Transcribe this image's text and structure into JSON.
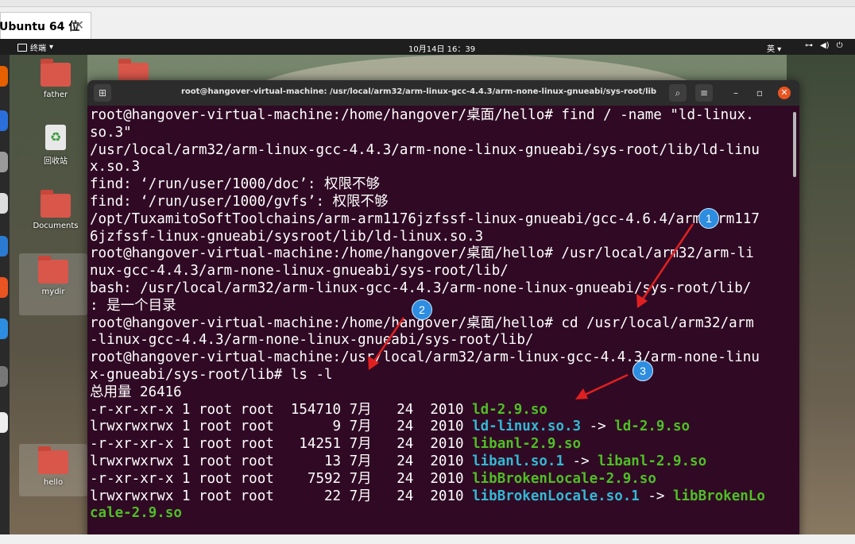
{
  "vm_window": {
    "tab_label": "Ubuntu 64 位",
    "tab_close": "✕"
  },
  "gnome_topbar": {
    "activities_label": "终端",
    "clock": "10月14日  16：39",
    "input_method": "英"
  },
  "desktop_icons": [
    {
      "label": "father"
    },
    {
      "label": "回收站"
    },
    {
      "label": "Documents"
    },
    {
      "label": "mydir"
    },
    {
      "label": "hello"
    }
  ],
  "terminal": {
    "title": "root@hangover-virtual-machine: /usr/local/arm32/arm-linux-gcc-4.4.3/arm-none-linux-gnueabi/sys-root/lib",
    "lines": [
      "root@hangover-virtual-machine:/home/hangover/桌面/hello# find / -name \"ld-linux.",
      "so.3\"",
      "/usr/local/arm32/arm-linux-gcc-4.4.3/arm-none-linux-gnueabi/sys-root/lib/ld-linu",
      "x.so.3",
      "find: ‘/run/user/1000/doc’: 权限不够",
      "find: ‘/run/user/1000/gvfs’: 权限不够",
      "/opt/TuxamitoSoftToolchains/arm-arm1176jzfssf-linux-gnueabi/gcc-4.6.4/arm-arm117",
      "6jzfssf-linux-gnueabi/sysroot/lib/ld-linux.so.3",
      "root@hangover-virtual-machine:/home/hangover/桌面/hello# /usr/local/arm32/arm-li",
      "nux-gcc-4.4.3/arm-none-linux-gnueabi/sys-root/lib/",
      "bash: /usr/local/arm32/arm-linux-gcc-4.4.3/arm-none-linux-gnueabi/sys-root/lib/",
      ": 是一个目录",
      "root@hangover-virtual-machine:/home/hangover/桌面/hello# cd /usr/local/arm32/arm",
      "-linux-gcc-4.4.3/arm-none-linux-gnueabi/sys-root/lib/",
      "root@hangover-virtual-machine:/usr/local/arm32/arm-linux-gcc-4.4.3/arm-none-linu",
      "x-gnueabi/sys-root/lib# ls -l",
      "总用量 26416"
    ],
    "listing": [
      {
        "perms": "-r-xr-xr-x 1 root root  154710 7月   24  2010 ",
        "name": "ld-2.9.so",
        "kind": "exec",
        "arrow": "",
        "target": ""
      },
      {
        "perms": "lrwxrwxrwx 1 root root       9 7月   24  2010 ",
        "name": "ld-linux.so.3",
        "kind": "link",
        "arrow": " -> ",
        "target": "ld-2.9.so"
      },
      {
        "perms": "-r-xr-xr-x 1 root root   14251 7月   24  2010 ",
        "name": "libanl-2.9.so",
        "kind": "exec",
        "arrow": "",
        "target": ""
      },
      {
        "perms": "lrwxrwxrwx 1 root root      13 7月   24  2010 ",
        "name": "libanl.so.1",
        "kind": "link",
        "arrow": " -> ",
        "target": "libanl-2.9.so"
      },
      {
        "perms": "-r-xr-xr-x 1 root root    7592 7月   24  2010 ",
        "name": "libBrokenLocale-2.9.so",
        "kind": "exec",
        "arrow": "",
        "target": ""
      },
      {
        "perms": "lrwxrwxrwx 1 root root      22 7月   24  2010 ",
        "name": "libBrokenLocale.so.1",
        "kind": "link",
        "arrow": " -> ",
        "target": "libBrokenLo"
      }
    ],
    "last_line": "cale-2.9.so",
    "colors": {
      "background": "#300a24",
      "text": "#ffffff",
      "exec": "#4fbf26",
      "link": "#34b8d4"
    }
  },
  "annotations": [
    {
      "number": "1"
    },
    {
      "number": "2"
    },
    {
      "number": "3"
    }
  ],
  "annotation_color": "#e02020"
}
